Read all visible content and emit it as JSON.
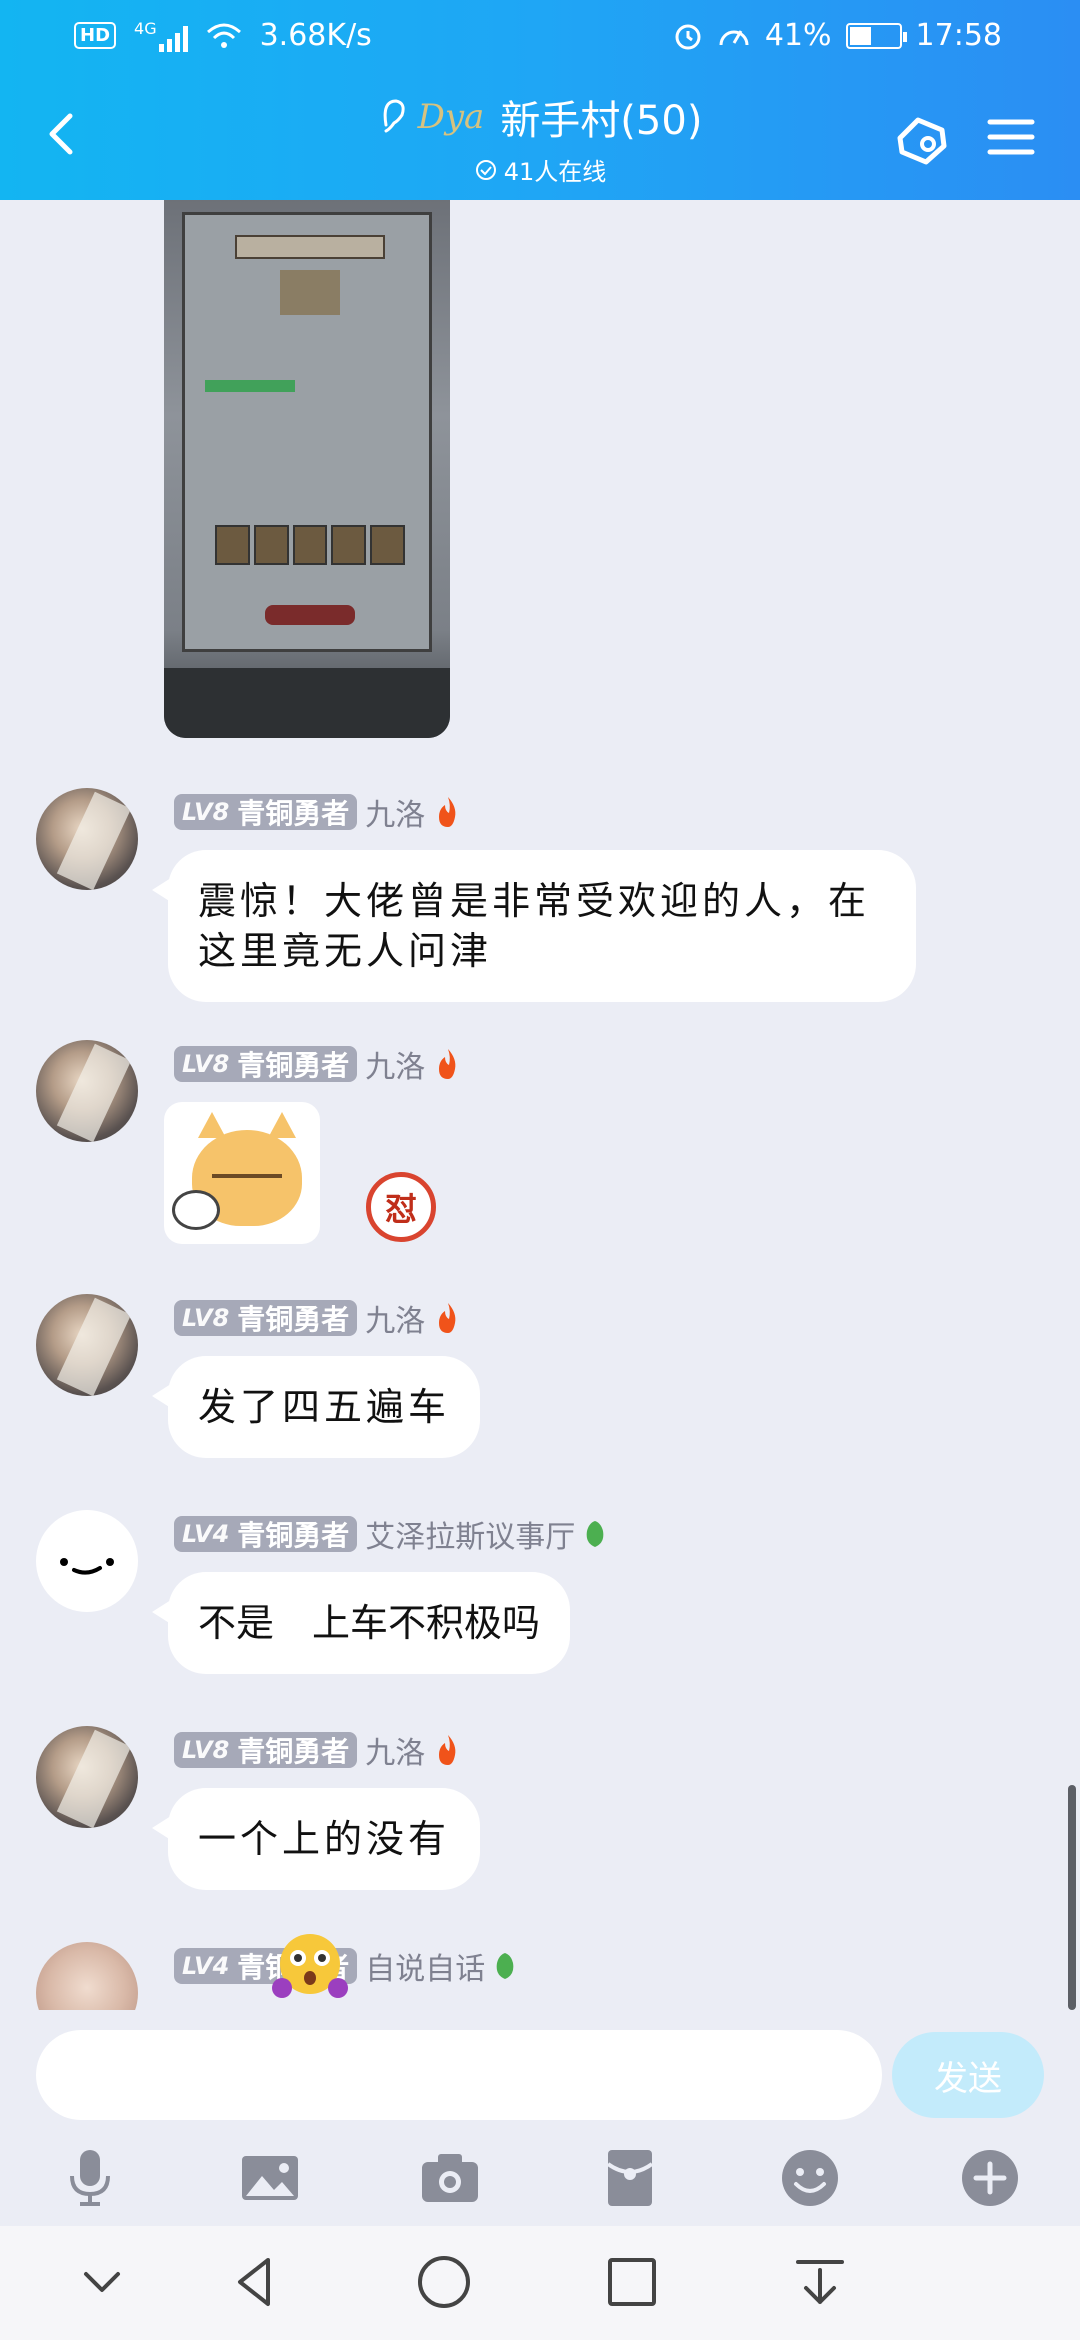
{
  "status_bar": {
    "hd": "HD",
    "network": "4G",
    "speed": "3.68K/s",
    "battery": "41%",
    "battery_level": 0.41,
    "time": "17:58"
  },
  "header": {
    "deco_text": "Dya",
    "title": "新手村(50)",
    "online": "41人在线"
  },
  "messages": [
    {
      "level": "LV8",
      "rank": "青铜勇者",
      "name": "九洛",
      "text": "震惊！大佬曾是非常受欢迎的人，在这里竟无人问津"
    },
    {
      "level": "LV8",
      "rank": "青铜勇者",
      "name": "九洛",
      "sticker_tag": "怼"
    },
    {
      "level": "LV8",
      "rank": "青铜勇者",
      "name": "九洛",
      "text": "发了四五遍车"
    },
    {
      "level": "LV4",
      "rank": "青铜勇者",
      "name": "艾泽拉斯议事厅",
      "text": "不是　上车不积极吗"
    },
    {
      "level": "LV8",
      "rank": "青铜勇者",
      "name": "九洛",
      "text": "一个上的没有"
    },
    {
      "level": "LV4",
      "rank": "青铜勇者",
      "name": "自说自话"
    }
  ],
  "composer": {
    "input_value": "",
    "send_label": "发送"
  },
  "icons": {
    "tools": [
      "microphone-icon",
      "image-icon",
      "camera-icon",
      "red-packet-icon",
      "emoji-icon",
      "plus-icon"
    ],
    "nav": [
      "collapse-icon",
      "back-icon",
      "home-icon",
      "recents-icon",
      "download-icon"
    ]
  }
}
